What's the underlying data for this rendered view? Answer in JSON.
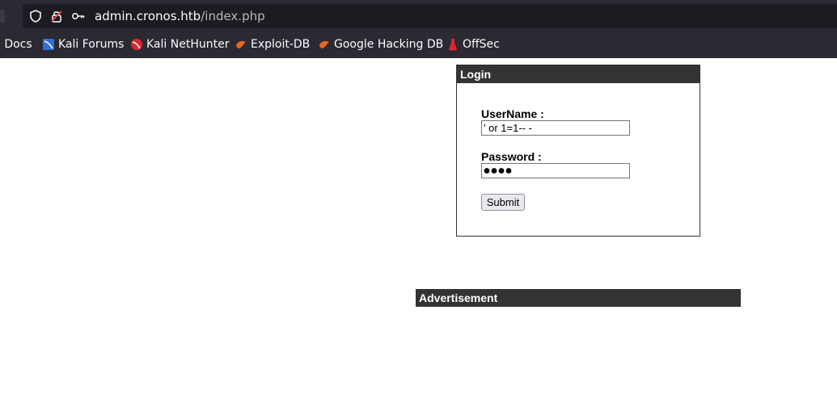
{
  "browser": {
    "url_host": "admin.cronos.htb",
    "url_path": "/index.php"
  },
  "bookmarks": [
    {
      "label": "i Docs",
      "icon": "kali-docs-icon"
    },
    {
      "label": "Kali Forums",
      "icon": "kali-forums-icon"
    },
    {
      "label": "Kali NetHunter",
      "icon": "kali-nethunter-icon"
    },
    {
      "label": "Exploit-DB",
      "icon": "exploit-db-icon"
    },
    {
      "label": "Google Hacking DB",
      "icon": "google-hacking-db-icon"
    },
    {
      "label": "OffSec",
      "icon": "offsec-icon"
    }
  ],
  "login": {
    "title": "Login",
    "username_label": "UserName :",
    "username_value": "' or 1=1-- -",
    "password_label": "Password :",
    "password_value": "1234",
    "submit_label": "Submit"
  },
  "advertisement": {
    "title": "Advertisement"
  }
}
